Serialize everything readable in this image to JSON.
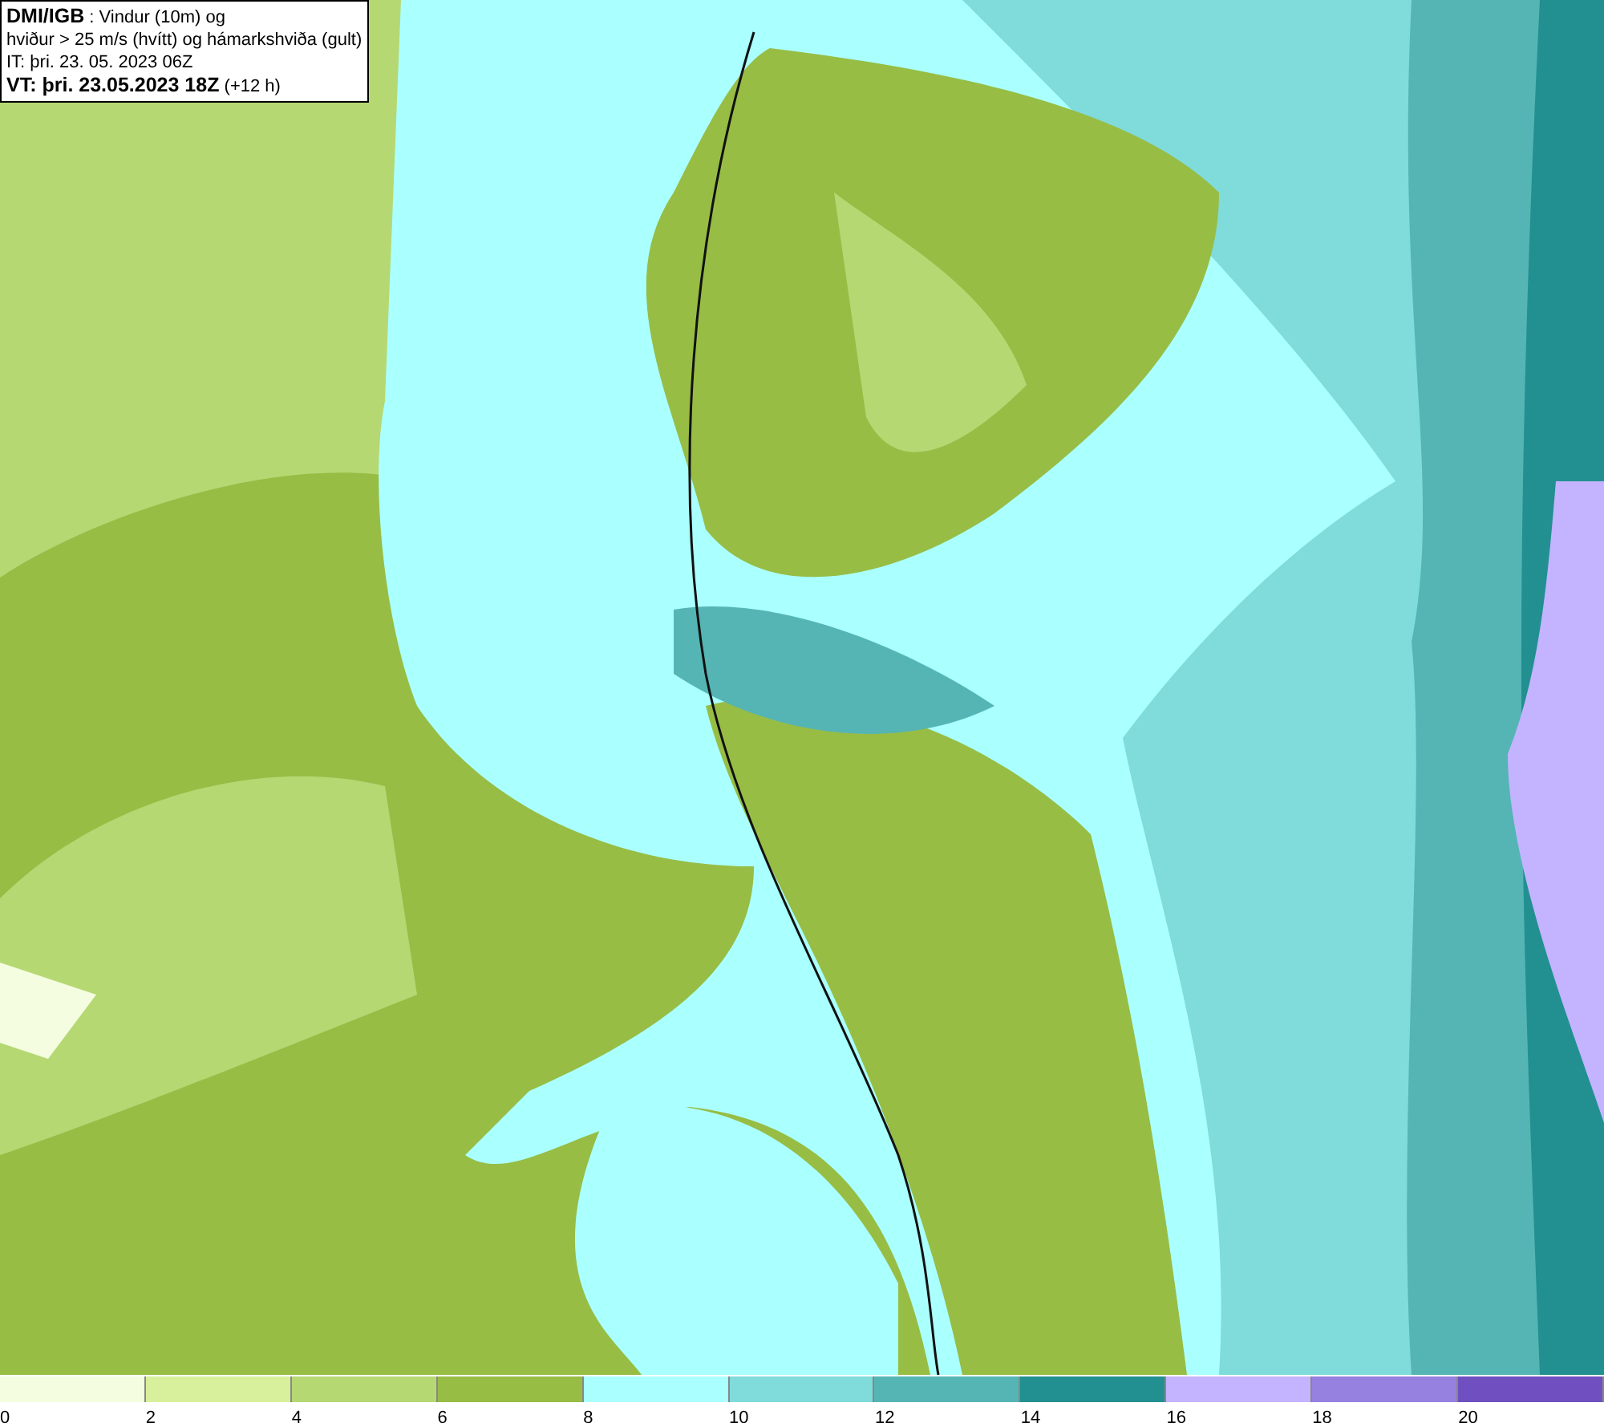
{
  "header": {
    "lines": [
      "**DMI/IGB** : Vindur (10m) og",
      "hviður > 25 m/s (hvítt) og hámarkshviða (gult)",
      "IT: þri. 23. 05. 2023 06Z",
      "**VT: þri. 23.05.2023 18Z** (+12 h)"
    ]
  },
  "legend": {
    "segments": [
      {
        "color": "#f4fde0",
        "label": "0"
      },
      {
        "color": "#d8f09c",
        "label": "2"
      },
      {
        "color": "#b6d873",
        "label": "4"
      },
      {
        "color": "#97bd45",
        "label": "6"
      },
      {
        "color": "#aaffff",
        "label": "8"
      },
      {
        "color": "#80dbdb",
        "label": "10"
      },
      {
        "color": "#55b5b5",
        "label": "12"
      },
      {
        "color": "#229090",
        "label": "14"
      },
      {
        "color": "#c4b3ff",
        "label": "16"
      },
      {
        "color": "#9680e0",
        "label": "18"
      },
      {
        "color": "#7050c0",
        "label": "20"
      }
    ]
  }
}
